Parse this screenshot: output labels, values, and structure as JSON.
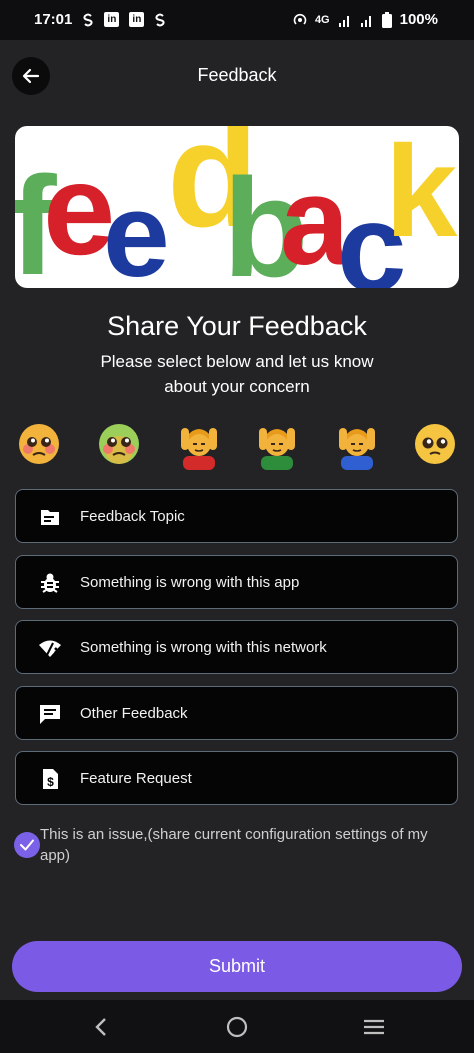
{
  "status_bar": {
    "time": "17:01",
    "network": "4G",
    "battery": "100%",
    "icons": [
      "s-icon",
      "linkedin-icon",
      "linkedin-icon",
      "s-icon",
      "hotspot-icon",
      "signal-icon",
      "signal-icon",
      "battery-icon"
    ]
  },
  "header": {
    "title": "Feedback",
    "back_icon": "arrow-left-icon"
  },
  "banner": {
    "letters": [
      "f",
      "e",
      "e",
      "d",
      "b",
      "a",
      "c",
      "k"
    ],
    "alt_logo": "feedback"
  },
  "main": {
    "title": "Share Your Feedback",
    "subtitle": "Please select below and let us know about your concern"
  },
  "emojis": [
    "pleading-face-icon",
    "pleading-face-icon",
    "person-face-palm-icon",
    "person-face-palm-icon",
    "person-face-palm-icon",
    "pleading-face-icon"
  ],
  "options": [
    {
      "label": "Feedback Topic",
      "icon": "topic-icon"
    },
    {
      "label": "Something is wrong with this app",
      "icon": "bug-icon"
    },
    {
      "label": "Something is wrong with this network",
      "icon": "wifi-off-icon"
    },
    {
      "label": "Other Feedback",
      "icon": "message-icon"
    },
    {
      "label": "Feature Request",
      "icon": "request-icon"
    }
  ],
  "issue_checkbox": {
    "checked": true,
    "label": "This is an issue,(share current configuration settings of my app)"
  },
  "submit_label": "Submit",
  "colors": {
    "background": "#232326",
    "accent": "#7b5be6",
    "option_border": "#5d6a78"
  }
}
